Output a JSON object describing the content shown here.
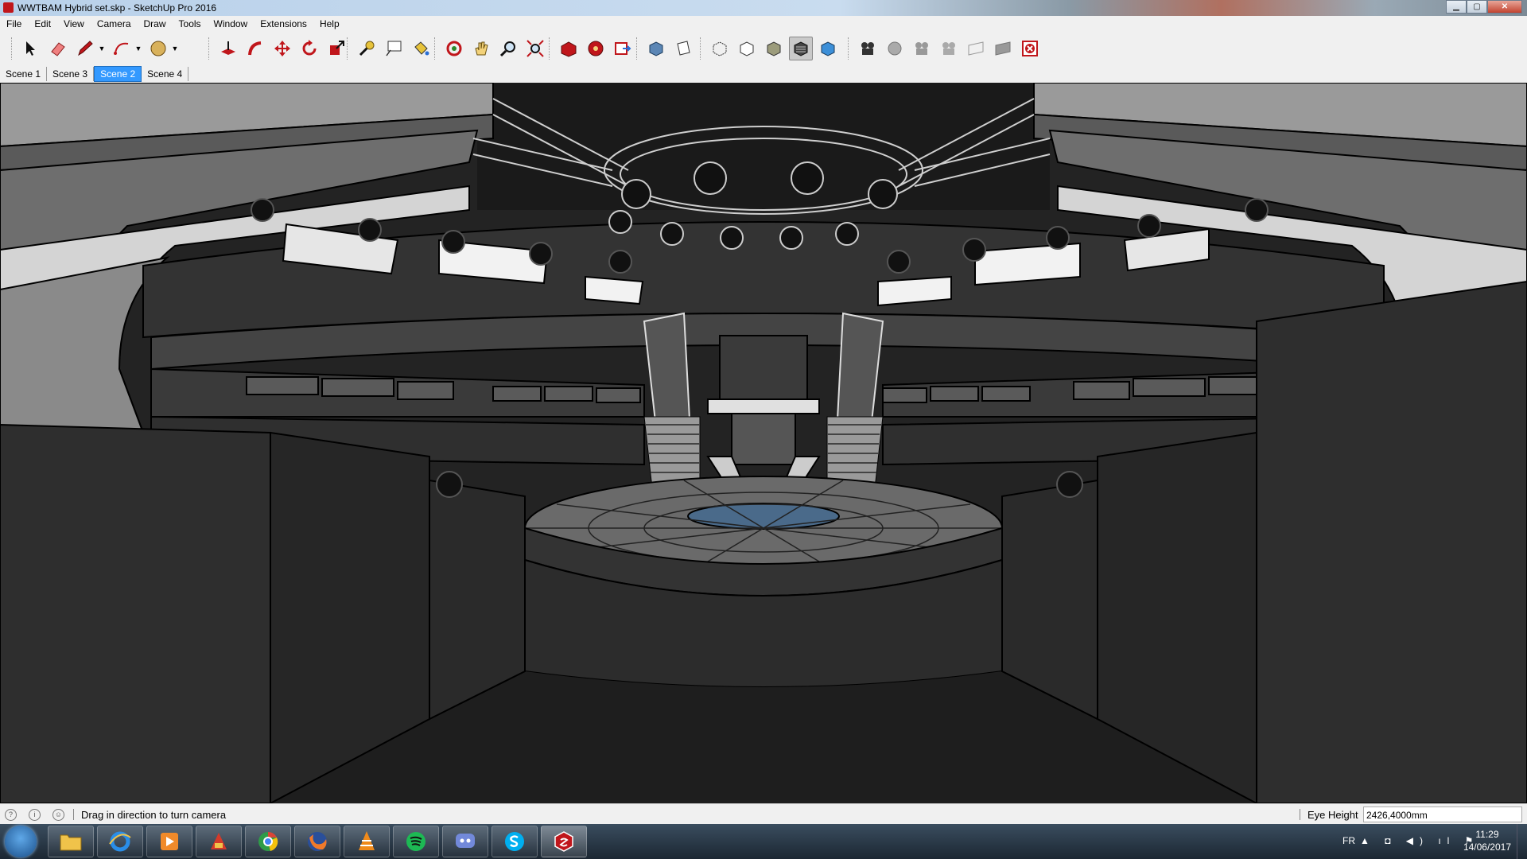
{
  "window": {
    "title": "WWTBAM Hybrid set.skp - SketchUp Pro 2016",
    "minimize_glyph": "▁",
    "maximize_glyph": "▢",
    "close_glyph": "✕"
  },
  "menu": {
    "items": [
      "File",
      "Edit",
      "View",
      "Camera",
      "Draw",
      "Tools",
      "Window",
      "Extensions",
      "Help"
    ]
  },
  "toolbar": {
    "dropdown_glyph": "▼",
    "text_tool_glyph": "A1"
  },
  "scenes": {
    "tabs": [
      "Scene 1",
      "Scene 3",
      "Scene 2",
      "Scene 4"
    ],
    "active_index": 2
  },
  "status": {
    "message": "Drag in direction to turn camera",
    "icon_glyphs": [
      "?",
      "i",
      "☺"
    ],
    "vcb_label": "Eye Height",
    "vcb_value": "2426,4000mm"
  },
  "taskbar": {
    "language": "FR",
    "time": "11:29",
    "date": "14/06/2017",
    "tray_glyphs": "▲ ◘ ◀) ıl ⚑"
  },
  "colors": {
    "accent_scene_tab": "#3399ff",
    "sketchup_red": "#c0161b"
  }
}
